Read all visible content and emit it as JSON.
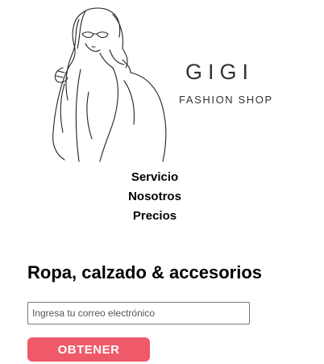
{
  "brand": {
    "name": "GIGI",
    "tagline": "FASHION SHOP"
  },
  "nav": {
    "items": [
      {
        "label": "Servicio"
      },
      {
        "label": "Nosotros"
      },
      {
        "label": "Precios"
      }
    ]
  },
  "hero": {
    "headline": "Ropa, calzado & accesorios"
  },
  "signup": {
    "email_placeholder": "Ingresa tu correo electrónico",
    "email_value": "",
    "button_label": "OBTENER"
  },
  "colors": {
    "accent": "#ef5a6a",
    "text": "#000000",
    "brand_text": "#333333"
  },
  "icons": {
    "logo": "woman-line-drawing-icon"
  }
}
